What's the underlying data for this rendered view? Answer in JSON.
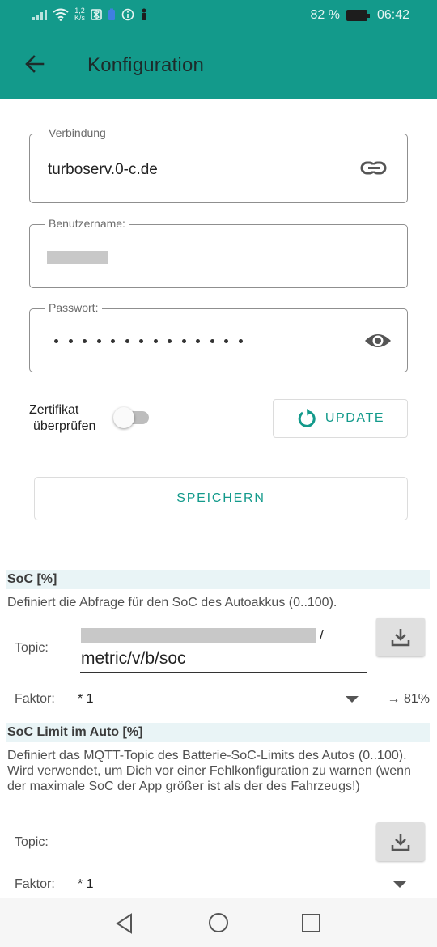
{
  "status_bar": {
    "net_speed_value": "1,2",
    "net_speed_unit": "K/s",
    "icons": [
      "signal-icon",
      "wifi-icon",
      "net-speed",
      "bluetooth-icon",
      "battery-saver-icon",
      "info-icon",
      "person-icon"
    ],
    "battery_percent": "82 %",
    "time": "06:42"
  },
  "app_bar": {
    "title": "Konfiguration",
    "back_icon": "arrow-back-icon"
  },
  "connection": {
    "label": "Verbindung",
    "value": "turboserv.0-c.de",
    "icon": "link-icon"
  },
  "username": {
    "label": "Benutzername:",
    "value_redacted": true
  },
  "password": {
    "label": "Passwort:",
    "masked_length": 14,
    "icon": "eye-icon"
  },
  "certificate": {
    "label_line1": "Zertifikat",
    "label_line2": "überprüfen",
    "enabled": false
  },
  "update_button": {
    "label": "UPDATE",
    "icon": "refresh-icon"
  },
  "save_button": {
    "label": "SPEICHERN"
  },
  "soc_section": {
    "title": "SoC [%]",
    "description": "Definiert die Abfrage für den SoC des Autoakkus (0..100).",
    "topic_label": "Topic:",
    "topic_separator": "/",
    "topic_value": "metric/v/b/soc",
    "factor_label": "Faktor:",
    "factor_value": "* 1",
    "result": "→ 81%"
  },
  "soc_limit_section": {
    "title": "SoC Limit im Auto [%]",
    "description": "Definiert das MQTT-Topic des Batterie-SoC-Limits des Autos (0..100). Wird verwendet, um Dich vor einer Fehlkonfiguration zu warnen (wenn der maximale SoC der App größer ist als der des Fahrzeugs!)",
    "topic_label": "Topic:",
    "topic_value": "",
    "factor_label": "Faktor:",
    "factor_value": "* 1"
  },
  "nav_bar": {
    "icons": [
      "nav-back-icon",
      "nav-home-icon",
      "nav-recents-icon"
    ]
  },
  "colors": {
    "accent": "#139a8b",
    "section_bg": "#e9f4f6"
  }
}
